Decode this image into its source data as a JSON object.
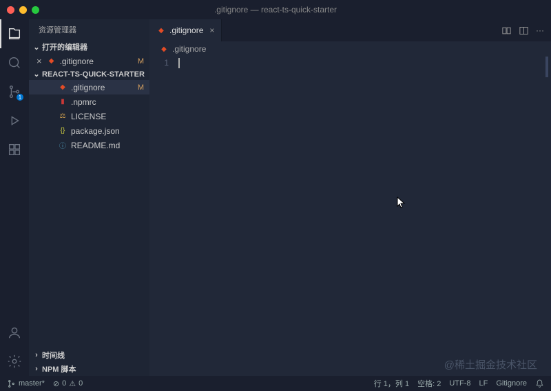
{
  "title": ".gitignore — react-ts-quick-starter",
  "sidebar": {
    "header": "资源管理器",
    "openEditors": "打开的编辑器",
    "project": "REACT-TS-QUICK-STARTER",
    "files": [
      {
        "name": ".gitignore",
        "status": "M",
        "type": "git"
      },
      {
        "name": ".npmrc",
        "type": "npm"
      },
      {
        "name": "LICENSE",
        "type": "lic"
      },
      {
        "name": "package.json",
        "type": "json"
      },
      {
        "name": "README.md",
        "type": "md"
      }
    ],
    "openFile": {
      "name": ".gitignore",
      "status": "M"
    },
    "timeline": "时间线",
    "npmScripts": "NPM 脚本"
  },
  "tabs": {
    "active": ".gitignore"
  },
  "breadcrumb": ".gitignore",
  "editor": {
    "lineNumber": "1"
  },
  "status": {
    "branch": "master*",
    "errors": "0",
    "warnings": "0",
    "line": "行 1，列 1",
    "spaces": "空格: 2",
    "encoding": "UTF-8",
    "eol": "LF",
    "lang": "Gitignore"
  },
  "scm": {
    "badge": "1"
  },
  "watermark": "@稀土掘金技术社区"
}
